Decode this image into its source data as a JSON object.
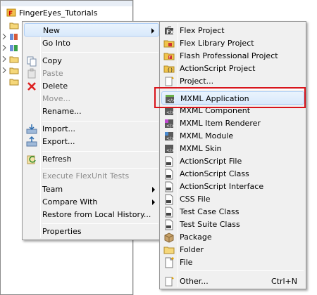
{
  "explorer": {
    "root_label": "FingerEyes_Tutorials"
  },
  "main_menu": {
    "items": [
      {
        "label": "New",
        "icon": "none",
        "submenu": true,
        "disabled": false,
        "hover": true
      },
      {
        "label": "Go Into",
        "icon": "none",
        "submenu": false,
        "disabled": false
      },
      {
        "label": "Copy",
        "icon": "copy-icon",
        "submenu": false,
        "disabled": false
      },
      {
        "label": "Paste",
        "icon": "paste-icon",
        "submenu": false,
        "disabled": true
      },
      {
        "label": "Delete",
        "icon": "delete-icon",
        "submenu": false,
        "disabled": false
      },
      {
        "label": "Move...",
        "icon": "none",
        "submenu": false,
        "disabled": true
      },
      {
        "label": "Rename...",
        "icon": "none",
        "submenu": false,
        "disabled": false
      },
      {
        "label": "Import...",
        "icon": "import-icon",
        "submenu": false,
        "disabled": false
      },
      {
        "label": "Export...",
        "icon": "export-icon",
        "submenu": false,
        "disabled": false
      },
      {
        "label": "Refresh",
        "icon": "refresh-icon",
        "submenu": false,
        "disabled": false
      },
      {
        "label": "Execute FlexUnit Tests",
        "icon": "none",
        "submenu": false,
        "disabled": true
      },
      {
        "label": "Team",
        "icon": "none",
        "submenu": true,
        "disabled": false
      },
      {
        "label": "Compare With",
        "icon": "none",
        "submenu": true,
        "disabled": false
      },
      {
        "label": "Restore from Local History...",
        "icon": "none",
        "submenu": false,
        "disabled": false
      },
      {
        "label": "Properties",
        "icon": "none",
        "submenu": false,
        "disabled": false
      }
    ]
  },
  "new_submenu": {
    "items": [
      {
        "label": "Flex Project",
        "icon": "flex-project-icon"
      },
      {
        "label": "Flex Library Project",
        "icon": "flex-library-project-icon"
      },
      {
        "label": "Flash Professional Project",
        "icon": "flash-professional-project-icon"
      },
      {
        "label": "ActionScript Project",
        "icon": "actionscript-project-icon"
      },
      {
        "label": "Project...",
        "icon": "project-icon"
      },
      {
        "label": "MXML Application",
        "icon": "mxml-application-icon"
      },
      {
        "label": "MXML Component",
        "icon": "mxml-component-icon"
      },
      {
        "label": "MXML Item Renderer",
        "icon": "mxml-item-renderer-icon"
      },
      {
        "label": "MXML Module",
        "icon": "mxml-module-icon"
      },
      {
        "label": "MXML Skin",
        "icon": "mxml-skin-icon"
      },
      {
        "label": "ActionScript File",
        "icon": "actionscript-file-icon"
      },
      {
        "label": "ActionScript Class",
        "icon": "actionscript-class-icon"
      },
      {
        "label": "ActionScript Interface",
        "icon": "actionscript-interface-icon"
      },
      {
        "label": "CSS File",
        "icon": "css-file-icon"
      },
      {
        "label": "Test Case Class",
        "icon": "test-case-class-icon"
      },
      {
        "label": "Test Suite Class",
        "icon": "test-suite-class-icon"
      },
      {
        "label": "Package",
        "icon": "package-icon"
      },
      {
        "label": "Folder",
        "icon": "folder-icon"
      },
      {
        "label": "File",
        "icon": "file-icon"
      },
      {
        "label": "Other...",
        "icon": "other-icon",
        "accel": "Ctrl+N"
      }
    ]
  },
  "colors": {
    "highlight_box": "#d9141b",
    "menu_bg": "#f0f0f0",
    "hover_bg": "#dcebfc"
  }
}
